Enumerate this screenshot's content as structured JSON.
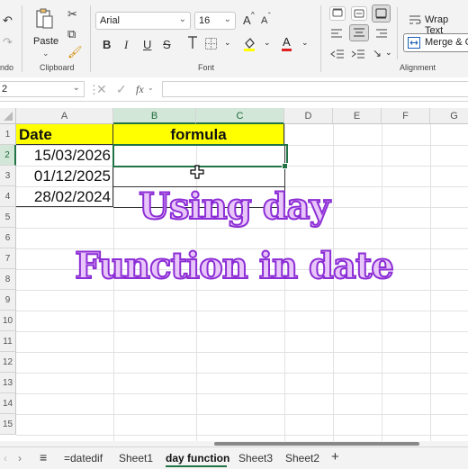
{
  "ribbon": {
    "undo_label": "ndo",
    "paste_label": "Paste",
    "clipboard_label": "Clipboard",
    "font_name": "Arial",
    "font_size": "16",
    "font_label": "Font",
    "wrap_text": "Wrap Text",
    "merge_center": "Merge & C",
    "alignment_label": "Alignment",
    "bold": "B",
    "italic": "I",
    "underline": "U",
    "strike": "S",
    "grow_font": "A",
    "shrink_font": "A",
    "font_color_glyph": "A"
  },
  "formula_bar": {
    "name_box": "2",
    "fx": "fx",
    "content": ""
  },
  "columns": [
    "A",
    "B",
    "C",
    "D",
    "E",
    "F",
    "G"
  ],
  "rows": [
    "1",
    "2",
    "3",
    "4",
    "5",
    "6",
    "7",
    "8",
    "9",
    "10",
    "11",
    "12",
    "13",
    "14",
    "15"
  ],
  "cells": {
    "a1": "Date",
    "bc1": "formula",
    "a2": "15/03/2026",
    "a3": "01/12/2025",
    "a4": "28/02/2024"
  },
  "overlay": {
    "line1": "Using day",
    "line2": "Function in date"
  },
  "sheet_tabs": {
    "items": [
      "=datedif",
      "Sheet1",
      "day function",
      "Sheet3",
      "Sheet2"
    ],
    "active": "day function",
    "add": "+",
    "menu": "≡"
  },
  "colors": {
    "header_fill": "#ffff00",
    "selection": "#217346",
    "overlay_fill": "#e9c6f9",
    "overlay_stroke": "#8c2ed6"
  }
}
